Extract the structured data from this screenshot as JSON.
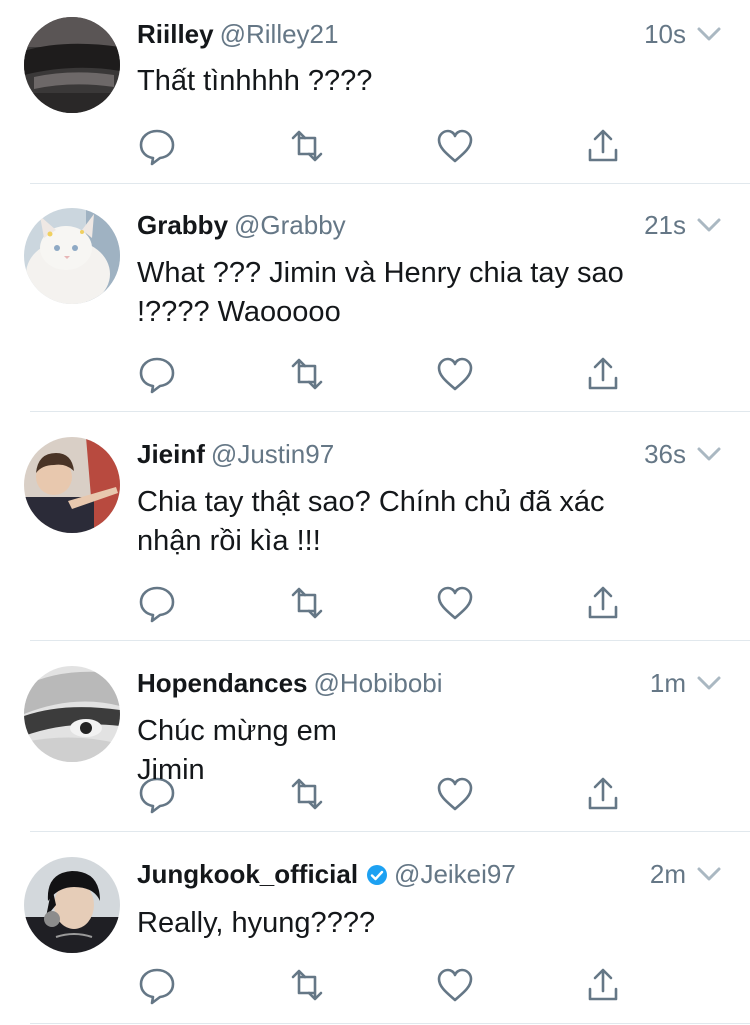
{
  "tweets": [
    {
      "name": "Riilley",
      "handle": "@Rilley21",
      "time": "10s",
      "text": "Thất tìnhhhh ????",
      "verified": false,
      "avatar": "dark-car-photo"
    },
    {
      "name": "Grabby",
      "handle": "@Grabby",
      "time": "21s",
      "text": "What ??? Jimin và Henry chia tay sao !???? Waooooo",
      "verified": false,
      "avatar": "white-cat-photo"
    },
    {
      "name": "Jieinf",
      "handle": "@Justin97",
      "time": "36s",
      "text": "Chia tay thật sao?  Chính chủ đã xác nhận rồi kìa !!!",
      "verified": false,
      "avatar": "person-photo"
    },
    {
      "name": "Hopendances",
      "handle": "@Hobibobi",
      "time": "1m",
      "text": "Chúc mừng em Jimin",
      "verified": false,
      "avatar": "bw-face-photo"
    },
    {
      "name": "Jungkook_official",
      "handle": "@Jeikei97",
      "time": "2m",
      "text": "Really, hyung????",
      "verified": true,
      "avatar": "dark-hair-person-photo"
    }
  ],
  "icons": {
    "reply": "reply-icon",
    "retweet": "retweet-icon",
    "like": "heart-icon",
    "share": "share-icon",
    "more": "chevron-down-icon",
    "verified": "verified-badge-icon"
  },
  "colors": {
    "name": "#14171a",
    "meta": "#657786",
    "icon": "#657786",
    "divider": "#e1e8ed",
    "verified": "#1da1f2"
  }
}
